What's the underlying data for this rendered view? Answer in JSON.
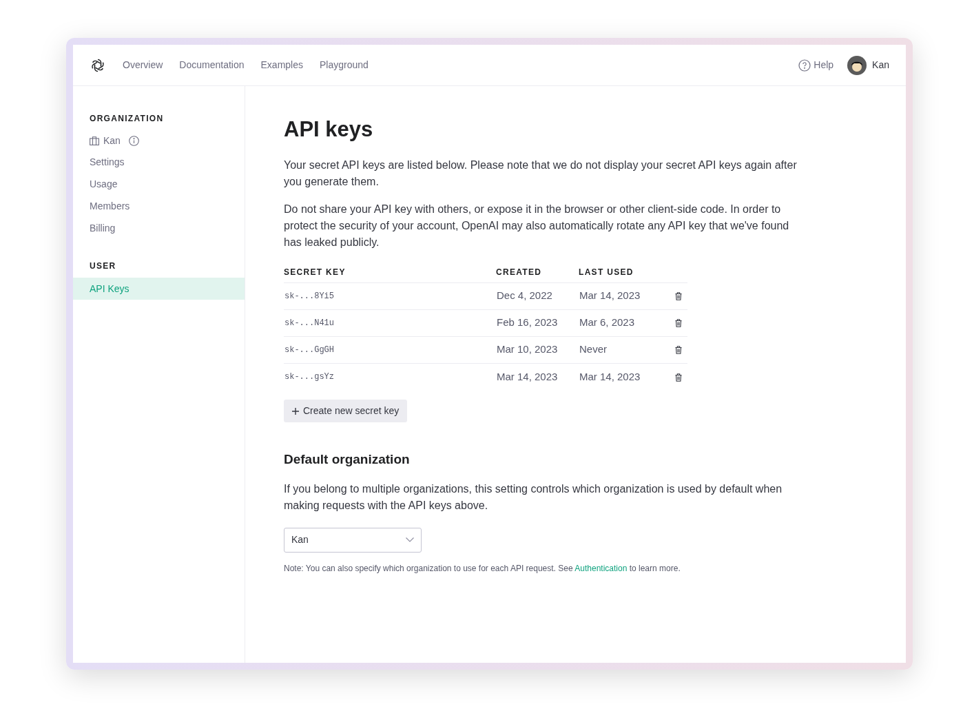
{
  "topnav": {
    "links": [
      "Overview",
      "Documentation",
      "Examples",
      "Playground"
    ],
    "help": "Help",
    "user": "Kan"
  },
  "sidebar": {
    "sections": [
      {
        "heading": "ORGANIZATION",
        "items": [
          {
            "label": "Kan",
            "kind": "org",
            "selected": false
          },
          {
            "label": "Settings",
            "kind": "link",
            "selected": false
          },
          {
            "label": "Usage",
            "kind": "link",
            "selected": false
          },
          {
            "label": "Members",
            "kind": "link",
            "selected": false
          },
          {
            "label": "Billing",
            "kind": "link",
            "selected": false
          }
        ]
      },
      {
        "heading": "USER",
        "items": [
          {
            "label": "API Keys",
            "kind": "link",
            "selected": true
          }
        ]
      }
    ]
  },
  "title": "API keys",
  "paragraphs": [
    "Your secret API keys are listed below. Please note that we do not display your secret API keys again after you generate them.",
    "Do not share your API key with others, or expose it in the browser or other client-side code. In order to protect the security of your account, OpenAI may also automatically rotate any API key that we've found has leaked publicly."
  ],
  "table": {
    "columns": [
      "SECRET KEY",
      "CREATED",
      "LAST USED"
    ],
    "rows": [
      [
        "sk-...8Yi5",
        "Dec 4, 2022",
        "Mar 14, 2023"
      ],
      [
        "sk-...N41u",
        "Feb 16, 2023",
        "Mar 6, 2023"
      ],
      [
        "sk-...GgGH",
        "Mar 10, 2023",
        "Never"
      ],
      [
        "sk-...gsYz",
        "Mar 14, 2023",
        "Mar 14, 2023"
      ]
    ]
  },
  "create_button": "Create new secret key",
  "default_org": {
    "heading": "Default organization",
    "text": "If you belong to multiple organizations, this setting controls which organization is used by default when making requests with the API keys above.",
    "select_value": "Kan",
    "note_before": "Note: You can also specify which organization to use for each API request. See ",
    "note_link": "Authentication",
    "note_after": " to learn more."
  }
}
